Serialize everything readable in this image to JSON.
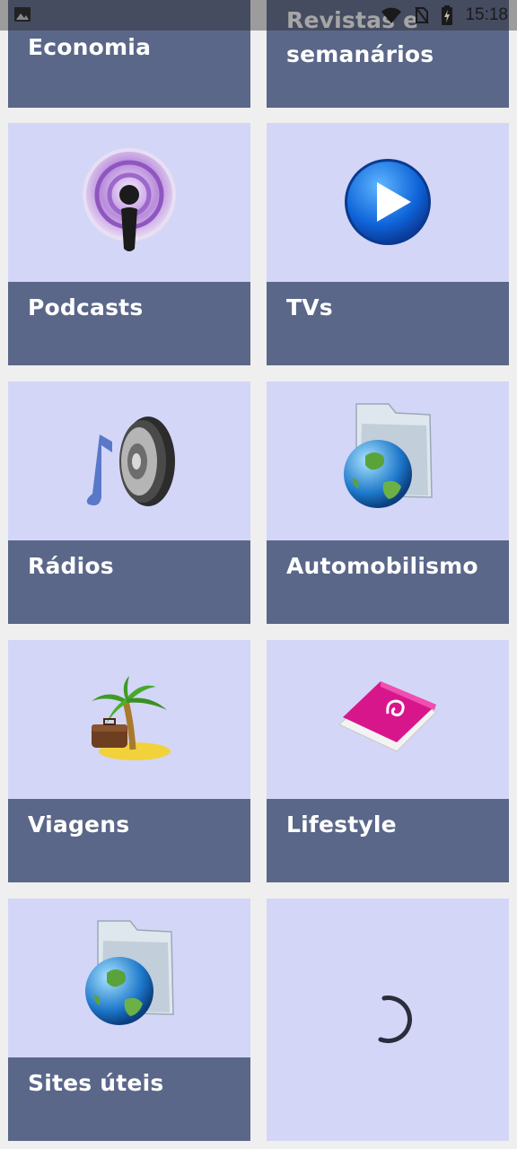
{
  "status_bar": {
    "time": "15:18",
    "icons": [
      "image-icon",
      "wifi-icon",
      "no-sim-icon",
      "battery-charging-icon"
    ]
  },
  "tiles": [
    {
      "label": "Economia",
      "icon": "none"
    },
    {
      "label": "Revistas e semanários",
      "icon": "none"
    },
    {
      "label": "Podcasts",
      "icon": "podcast-icon"
    },
    {
      "label": "TVs",
      "icon": "play-icon"
    },
    {
      "label": "Rádios",
      "icon": "speaker-music-icon"
    },
    {
      "label": "Automobilismo",
      "icon": "globe-folder-icon"
    },
    {
      "label": "Viagens",
      "icon": "palm-island-icon"
    },
    {
      "label": "Lifestyle",
      "icon": "debian-book-icon"
    },
    {
      "label": "Sites úteis",
      "icon": "globe-folder-icon"
    },
    {
      "label": "",
      "icon": "loading-spinner-icon"
    }
  ],
  "colors": {
    "tile_background": "#d3d6f7",
    "label_bar": "#5a6789",
    "page_background": "#efefef"
  }
}
